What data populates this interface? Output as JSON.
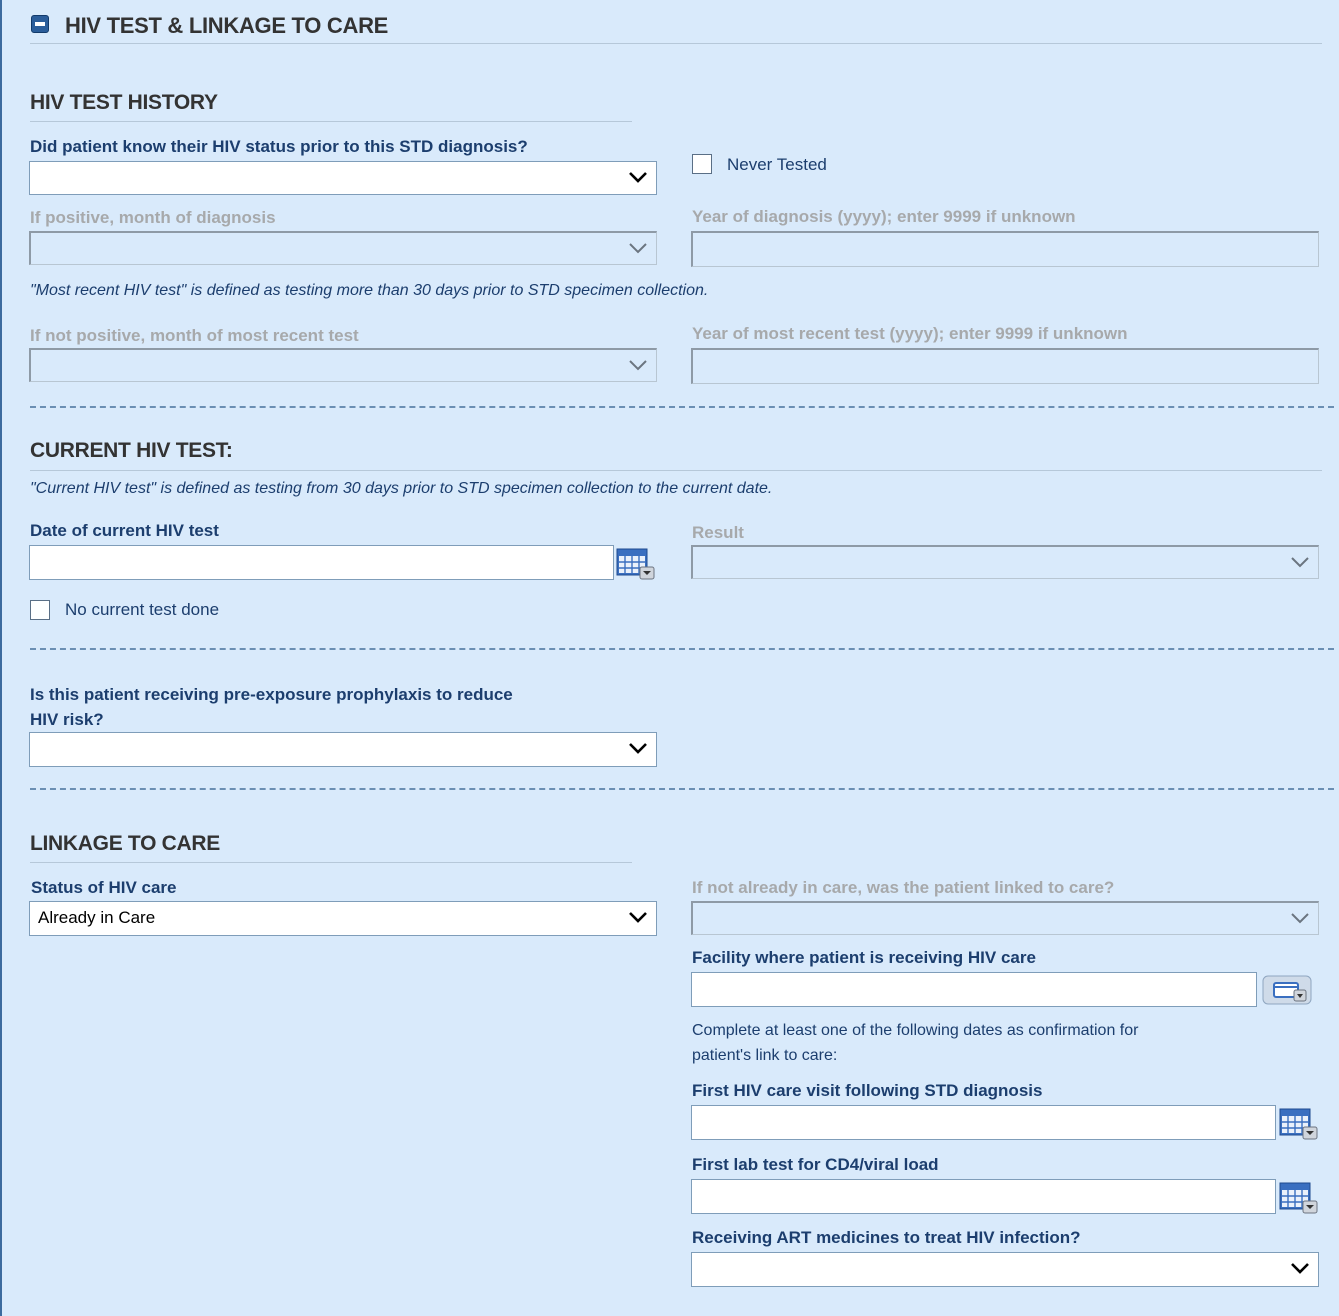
{
  "section": {
    "title": "HIV TEST & LINKAGE TO CARE",
    "collapse_icon": "minus-icon"
  },
  "history": {
    "title": "HIV TEST HISTORY",
    "know_status_label": "Did patient know their HIV status prior to this STD diagnosis?",
    "know_status_value": "",
    "never_tested_label": "Never Tested",
    "never_tested_checked": false,
    "pos_month_label": "If positive, month of diagnosis",
    "pos_year_label": "Year of diagnosis (yyyy); enter 9999 if unknown",
    "recent_note": "\"Most recent HIV test\" is defined as testing more than 30 days prior to STD specimen collection.",
    "notpos_month_label": "If not positive, month of most recent test",
    "notpos_year_label": "Year of most recent test (yyyy); enter 9999 if unknown"
  },
  "current": {
    "title": "CURRENT HIV TEST:",
    "note": "\"Current HIV test\" is defined as testing from 30 days prior to STD specimen collection to the current date.",
    "date_label": "Date of current HIV test",
    "date_value": "",
    "result_label": "Result",
    "no_test_label": "No current test done",
    "no_test_checked": false
  },
  "prep": {
    "label_line1": "Is this patient receiving pre-exposure prophylaxis to reduce",
    "label_line2": "HIV risk?",
    "value": ""
  },
  "linkage": {
    "title": "LINKAGE TO CARE",
    "status_label": "Status of HIV care",
    "status_value": "Already in Care",
    "linked_label": "If not already in care, was the patient linked to care?",
    "facility_label": "Facility where patient is receiving HIV care",
    "facility_value": "",
    "confirm_note_line1": "Complete at least one of the following dates as confirmation for",
    "confirm_note_line2": "patient's link to care:",
    "first_visit_label": "First HIV care visit following STD diagnosis",
    "first_lab_label": "First lab test for CD4/viral load",
    "art_label": "Receiving ART medicines to treat HIV infection?",
    "art_value": ""
  },
  "colors": {
    "background": "#d9eafb",
    "label": "#1c3e6e",
    "disabled": "#a7a9ab",
    "accent": "#2a5d9a"
  }
}
